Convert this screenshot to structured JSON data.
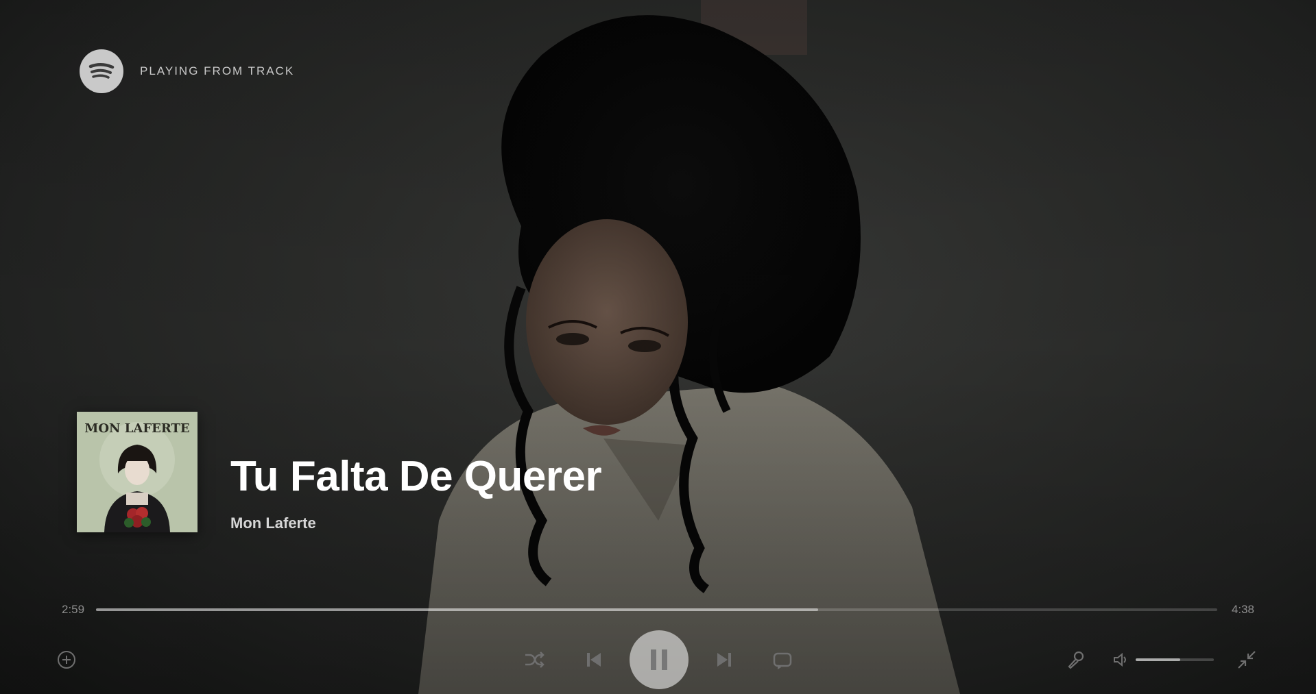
{
  "header": {
    "context_label": "PLAYING FROM TRACK",
    "logo_icon": "spotify-logo-icon"
  },
  "track": {
    "title": "Tu Falta De Querer",
    "artist": "Mon Laferte",
    "cover_icon": "album-cover-image"
  },
  "playback": {
    "elapsed": "2:59",
    "duration": "4:38",
    "progress": 0.644,
    "volume": 0.57,
    "is_playing": true
  },
  "icons": {
    "add": "add-circle-icon",
    "shuffle": "shuffle-icon",
    "previous": "skip-previous-icon",
    "pause": "pause-icon",
    "next": "skip-next-icon",
    "repeat": "repeat-icon",
    "lyrics": "microphone-icon",
    "volume": "volume-icon",
    "exit_fullscreen": "minimize-fullscreen-icon"
  },
  "colors": {
    "accent": "#ffffff",
    "muted": "#8d8d8d",
    "logo": "#c9c9c9"
  }
}
